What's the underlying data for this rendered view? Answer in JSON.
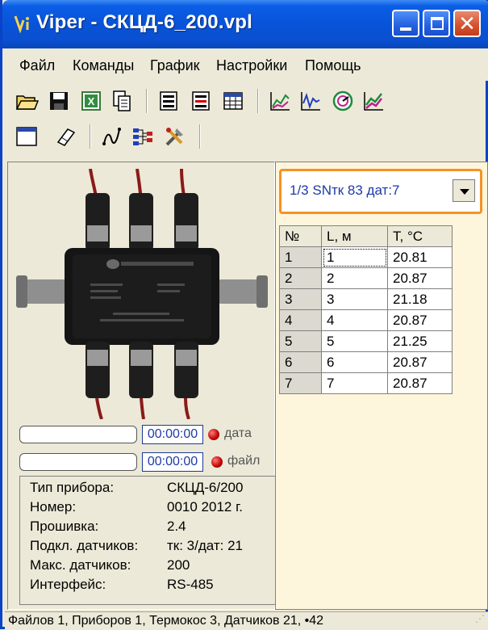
{
  "window": {
    "title": "Viper - СКЦД-6_200.vpl",
    "close_glyph": "✕"
  },
  "menu": [
    "Файл",
    "Команды",
    "График",
    "Настройки",
    "Помощь"
  ],
  "toolbar": {
    "row1": [
      "open-folder-icon",
      "save-icon",
      "excel-export-icon",
      "copy-icon",
      "list-view-icon",
      "list-red-icon",
      "table-view-icon",
      "chart-area-icon",
      "chart-line-icon",
      "gauge-icon",
      "chart-trend-icon"
    ],
    "row2": [
      "window-icon",
      "eraser-icon",
      "curve-icon",
      "network-icon",
      "tools-icon"
    ]
  },
  "progress": {
    "date": {
      "time": "00:00:00",
      "label": "дата"
    },
    "file": {
      "time": "00:00:00",
      "label": "файл"
    }
  },
  "device_info": [
    {
      "label": "Тип прибора:",
      "value": "СКЦД-6/200"
    },
    {
      "label": "Номер:",
      "value": "0010  2012 г."
    },
    {
      "label": "Прошивка:",
      "value": "2.4"
    },
    {
      "label": "Подкл. датчиков:",
      "value": "тк: 3/дат: 21"
    },
    {
      "label": "Макс. датчиков:",
      "value": "200"
    },
    {
      "label": "Интерфейс:",
      "value": "RS-485"
    }
  ],
  "selector": {
    "value": "1/3 SNтк 83 дат:7"
  },
  "table": {
    "headers": [
      "№",
      "L, м",
      "T, °C"
    ],
    "rows": [
      [
        "1",
        "1",
        "20.81"
      ],
      [
        "2",
        "2",
        "20.87"
      ],
      [
        "3",
        "3",
        "21.18"
      ],
      [
        "4",
        "4",
        "20.87"
      ],
      [
        "5",
        "5",
        "21.25"
      ],
      [
        "6",
        "6",
        "20.87"
      ],
      [
        "7",
        "7",
        "20.87"
      ]
    ]
  },
  "status": {
    "text": "Файлов 1, Приборов 1, Термокос 3, Датчиков 21, •42"
  },
  "colors": {
    "accent": "#f39325",
    "title_blue": "#0853d8",
    "panel_cream": "#fef6dc"
  }
}
